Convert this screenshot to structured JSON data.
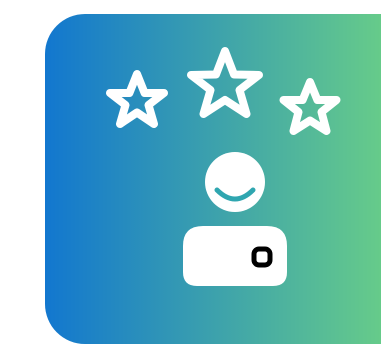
{
  "icon": {
    "name": "customer-rating-icon",
    "gradient": {
      "from": "#1277cf",
      "to": "#66cb8a"
    },
    "glyph_color": "#ffffff",
    "badge_color": "#000000",
    "rating": {
      "stars_filled": 0,
      "stars_total": 3
    }
  }
}
